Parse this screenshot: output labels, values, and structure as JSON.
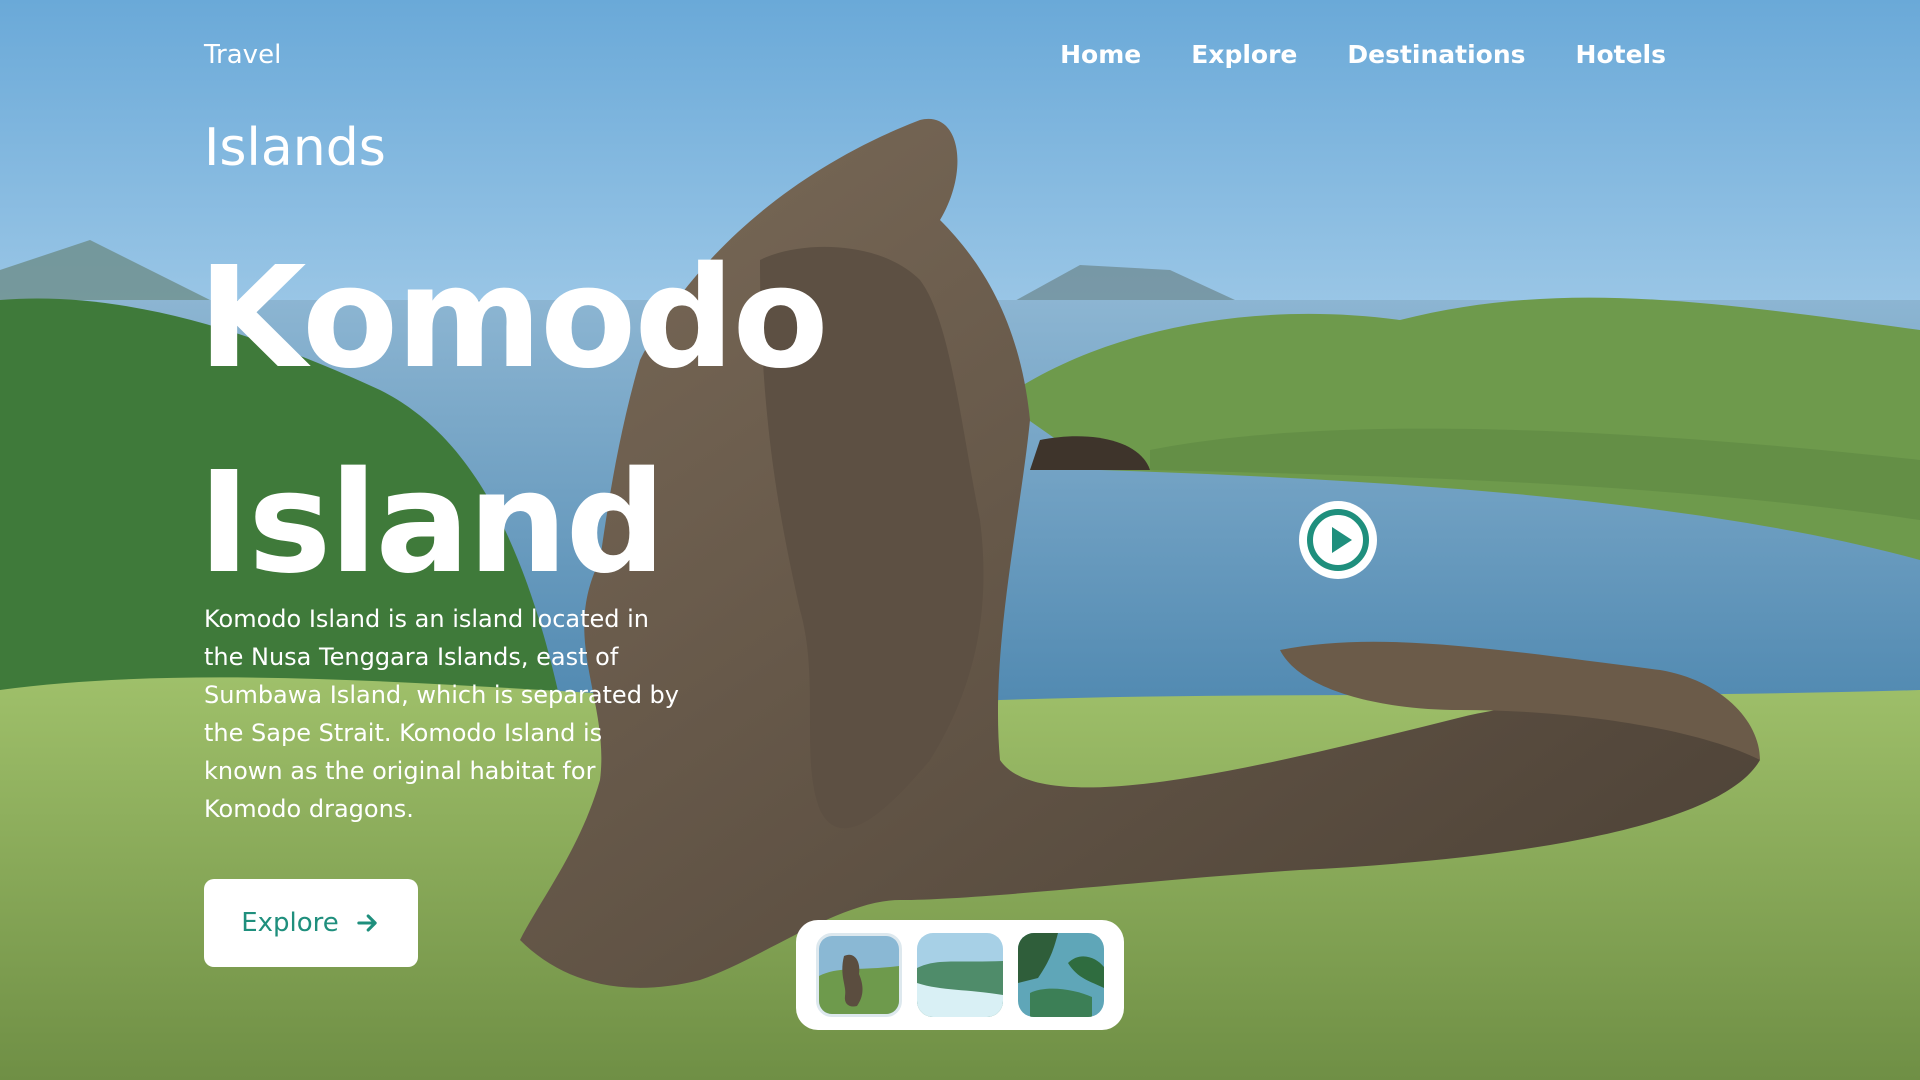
{
  "brand": "Travel",
  "nav": [
    "Home",
    "Explore",
    "Destinations",
    "Hotels"
  ],
  "hero": {
    "subtitle": "Islands",
    "title_line1": "Komodo",
    "title_line2": "Island",
    "description": "Komodo Island is an island located in the Nusa Tenggara Islands, east of Sumbawa Island, which is separated by the Sape Strait. Komodo Island is known as the original habitat for Komodo dragons.",
    "button_label": "Explore"
  },
  "icons": {
    "play": "play-circle-icon",
    "arrow": "arrow-right-icon"
  },
  "colors": {
    "accent": "#1f8f7d",
    "sky": "#a9cfe8",
    "sea": "#5f95b8",
    "hill": "#6f9b4f",
    "grass": "#93b95f"
  }
}
